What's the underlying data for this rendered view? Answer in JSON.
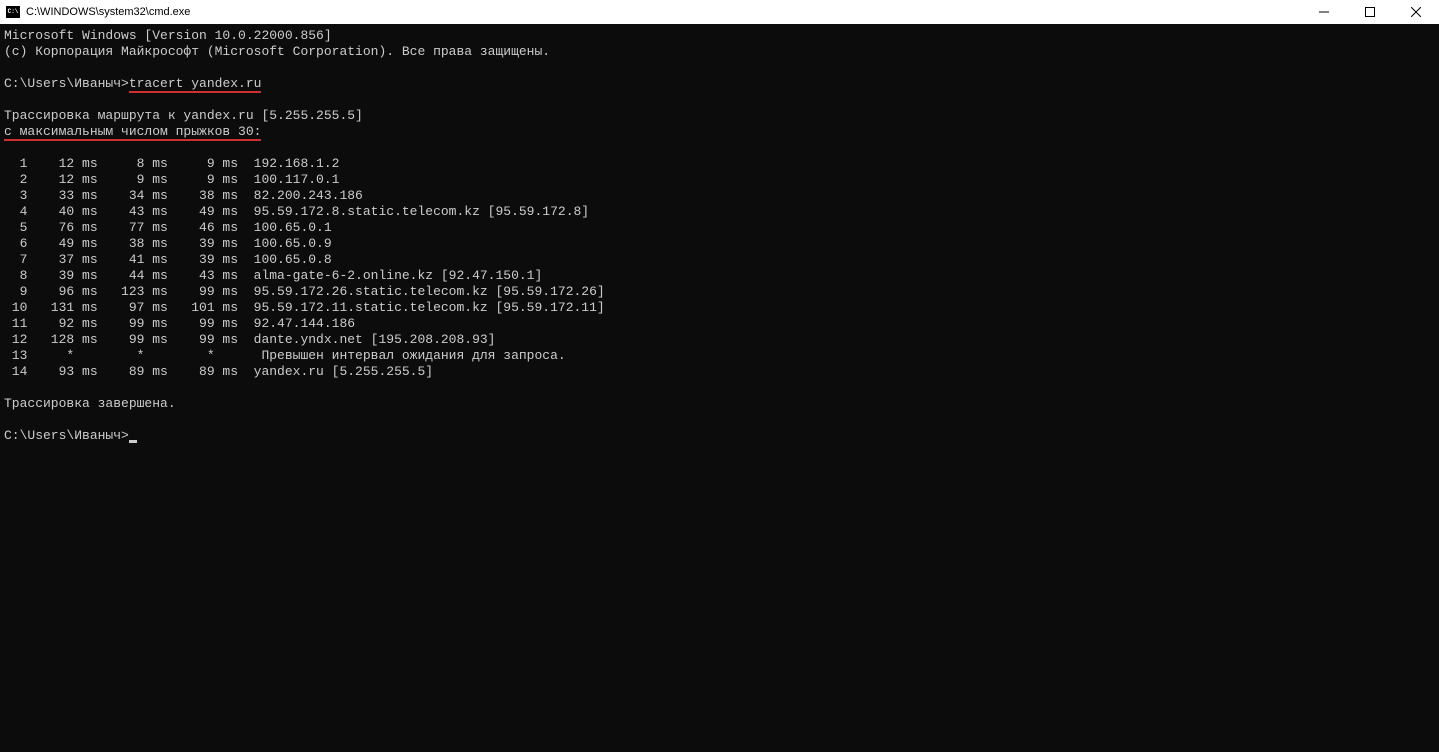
{
  "titlebar": {
    "title": "C:\\WINDOWS\\system32\\cmd.exe"
  },
  "terminal": {
    "version_line": "Microsoft Windows [Version 10.0.22000.856]",
    "copyright_line": "(c) Корпорация Майкрософт (Microsoft Corporation). Все права защищены.",
    "prompt1_path": "C:\\Users\\Иваныч>",
    "prompt1_command": "tracert yandex.ru",
    "trace_line1": "Трассировка маршрута к yandex.ru [5.255.255.5]",
    "trace_line2": "с максимальным числом прыжков 30:",
    "hops": [
      {
        "n": "  1",
        "t1": "   12 ms",
        "t2": "    8 ms",
        "t3": "    9 ms",
        "host": "192.168.1.2"
      },
      {
        "n": "  2",
        "t1": "   12 ms",
        "t2": "    9 ms",
        "t3": "    9 ms",
        "host": "100.117.0.1"
      },
      {
        "n": "  3",
        "t1": "   33 ms",
        "t2": "   34 ms",
        "t3": "   38 ms",
        "host": "82.200.243.186"
      },
      {
        "n": "  4",
        "t1": "   40 ms",
        "t2": "   43 ms",
        "t3": "   49 ms",
        "host": "95.59.172.8.static.telecom.kz [95.59.172.8]"
      },
      {
        "n": "  5",
        "t1": "   76 ms",
        "t2": "   77 ms",
        "t3": "   46 ms",
        "host": "100.65.0.1"
      },
      {
        "n": "  6",
        "t1": "   49 ms",
        "t2": "   38 ms",
        "t3": "   39 ms",
        "host": "100.65.0.9"
      },
      {
        "n": "  7",
        "t1": "   37 ms",
        "t2": "   41 ms",
        "t3": "   39 ms",
        "host": "100.65.0.8"
      },
      {
        "n": "  8",
        "t1": "   39 ms",
        "t2": "   44 ms",
        "t3": "   43 ms",
        "host": "alma-gate-6-2.online.kz [92.47.150.1]"
      },
      {
        "n": "  9",
        "t1": "   96 ms",
        "t2": "  123 ms",
        "t3": "   99 ms",
        "host": "95.59.172.26.static.telecom.kz [95.59.172.26]"
      },
      {
        "n": " 10",
        "t1": "  131 ms",
        "t2": "   97 ms",
        "t3": "  101 ms",
        "host": "95.59.172.11.static.telecom.kz [95.59.172.11]"
      },
      {
        "n": " 11",
        "t1": "   92 ms",
        "t2": "   99 ms",
        "t3": "   99 ms",
        "host": "92.47.144.186"
      },
      {
        "n": " 12",
        "t1": "  128 ms",
        "t2": "   99 ms",
        "t3": "   99 ms",
        "host": "dante.yndx.net [195.208.208.93]"
      },
      {
        "n": " 13",
        "t1": "    *   ",
        "t2": "    *   ",
        "t3": "    *   ",
        "host": " Превышен интервал ожидания для запроса."
      },
      {
        "n": " 14",
        "t1": "   93 ms",
        "t2": "   89 ms",
        "t3": "   89 ms",
        "host": "yandex.ru [5.255.255.5]"
      }
    ],
    "trace_done": "Трассировка завершена.",
    "prompt2_path": "C:\\Users\\Иваныч>"
  }
}
